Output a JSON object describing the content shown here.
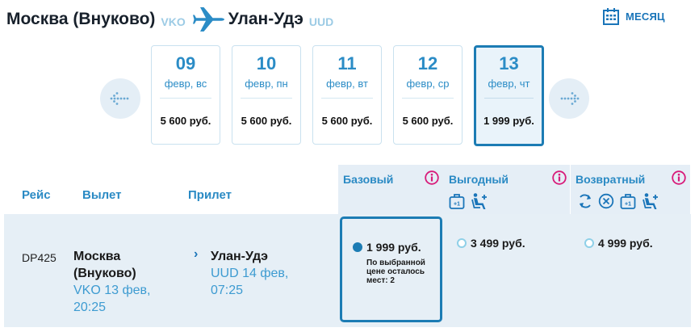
{
  "header": {
    "from_city": "Москва (Внуково)",
    "from_code": "VKO",
    "to_city": "Улан-Удэ",
    "to_code": "UUD",
    "month_label": "МЕСЯЦ"
  },
  "dates": [
    {
      "day": "09",
      "weekday": "февр, вс",
      "price": "5 600 руб."
    },
    {
      "day": "10",
      "weekday": "февр, пн",
      "price": "5 600 руб."
    },
    {
      "day": "11",
      "weekday": "февр, вт",
      "price": "5 600 руб."
    },
    {
      "day": "12",
      "weekday": "февр, ср",
      "price": "5 600 руб."
    },
    {
      "day": "13",
      "weekday": "февр, чт",
      "price": "1 999 руб."
    }
  ],
  "table": {
    "col_flight": "Рейс",
    "col_depart": "Вылет",
    "col_arrive": "Прилет",
    "fares": [
      {
        "title": "Базовый"
      },
      {
        "title": "Выгодный"
      },
      {
        "title": "Возвратный"
      }
    ]
  },
  "flight": {
    "number": "DP425",
    "dep_city_line1": "Москва",
    "dep_city_line2": "(Внуково)",
    "dep_info_line1": "VKO 13 фев,",
    "dep_info_line2": "20:25",
    "arr_city": "Улан-Удэ",
    "arr_info_line1": "UUD 14 фев,",
    "arr_info_line2": "07:25",
    "prices": [
      {
        "price": "1 999 руб.",
        "note": "По выбранной цене осталось мест: 2",
        "selected": true
      },
      {
        "price": "3 499 руб.",
        "selected": false
      },
      {
        "price": "4 999 руб.",
        "selected": false
      }
    ]
  },
  "colors": {
    "accent": "#2a8ac4",
    "selected_border": "#1c7cb4",
    "info_icon": "#d81b7a",
    "row_bg": "#e6eff6"
  }
}
